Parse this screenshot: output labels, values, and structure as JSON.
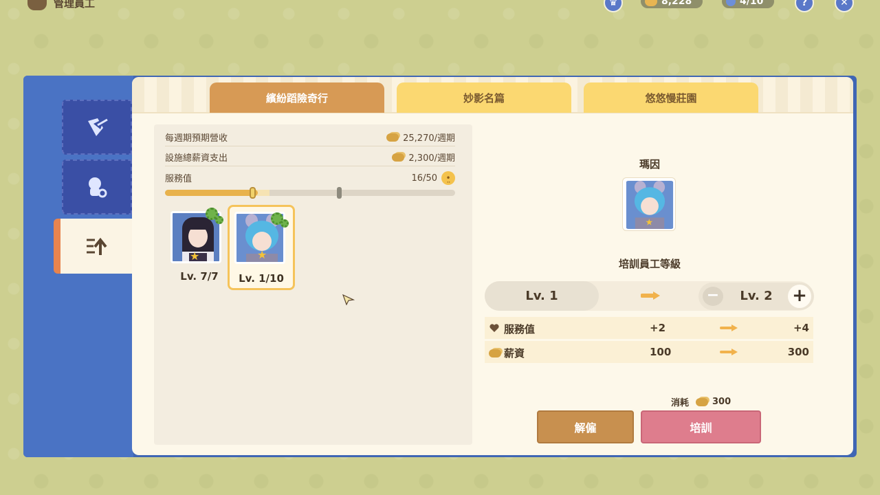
{
  "topbar": {
    "title": "管理員工",
    "coins": "8,228",
    "staff": "4/10"
  },
  "tabs": [
    {
      "label": "繽紛蹈險奇行",
      "active": true
    },
    {
      "label": "妙影名篇",
      "active": false
    },
    {
      "label": "悠悠慢莊園",
      "active": false
    }
  ],
  "stats": {
    "weekly_revenue_label": "每週期預期營收",
    "weekly_revenue_value": "25,270/週期",
    "salary_label": "設施總薪資支出",
    "salary_value": "2,300/週期",
    "service_label": "服務值",
    "service_value": "16/50",
    "service_fraction": 0.32
  },
  "employees": [
    {
      "level": "Lv. 7/7",
      "selected": false
    },
    {
      "level": "Lv. 1/10",
      "selected": true
    }
  ],
  "detail": {
    "name": "瑪因",
    "train_title": "培訓員工等級",
    "current_level": "Lv. 1",
    "next_level": "Lv. 2",
    "attrs": [
      {
        "label": "服務值",
        "from": "+2",
        "to": "+4",
        "icon": "heart-icon"
      },
      {
        "label": "薪資",
        "from": "100",
        "to": "300",
        "icon": "coin-icon"
      }
    ],
    "cost_label": "消耗",
    "cost_value": "300",
    "fire_label": "解僱",
    "train_label": "培訓",
    "minus": "−",
    "plus": "+"
  },
  "colors": {
    "accent_tab": "#d79a55",
    "inactive_tab": "#fbd871",
    "frame_blue": "#3f66b4",
    "train_button": "#de7d8d",
    "fire_button": "#c8904f"
  }
}
